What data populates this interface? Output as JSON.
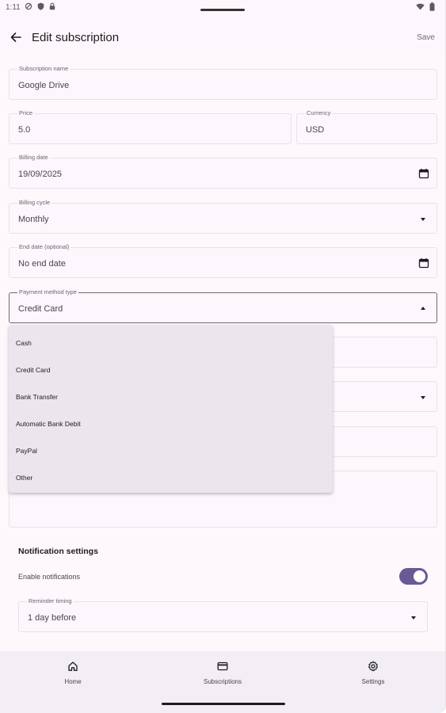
{
  "status_bar": {
    "time": "1:11"
  },
  "app_bar": {
    "title": "Edit subscription",
    "save_label": "Save"
  },
  "form": {
    "subscription_name": {
      "label": "Subscription name",
      "value": "Google Drive"
    },
    "price": {
      "label": "Price",
      "value": "5.0"
    },
    "currency": {
      "label": "Currency",
      "value": "USD"
    },
    "billing_date": {
      "label": "Billing date",
      "value": "19/09/2025"
    },
    "billing_cycle": {
      "label": "Billing cycle",
      "value": "Monthly"
    },
    "end_date": {
      "label": "End date (optional)",
      "value": "No end date"
    },
    "payment_method_type": {
      "label": "Payment method type",
      "value": "Credit Card"
    }
  },
  "payment_menu": {
    "items": [
      "Cash",
      "Credit Card",
      "Bank Transfer",
      "Automatic Bank Debit",
      "PayPal",
      "Other"
    ]
  },
  "notifications": {
    "title": "Notification settings",
    "enable_label": "Enable notifications",
    "enabled": true,
    "reminder_timing": {
      "label": "Reminder timing",
      "value": "1 day before"
    }
  },
  "bottom_nav": {
    "items": [
      {
        "label": "Home",
        "icon": "home-icon"
      },
      {
        "label": "Subscriptions",
        "icon": "credit-card-icon"
      },
      {
        "label": "Settings",
        "icon": "gear-icon"
      }
    ]
  },
  "colors": {
    "accent": "#6a5a94",
    "background": "#fdf7fd",
    "menu_background": "#ebe6ed",
    "nav_background": "#f3edf5"
  }
}
